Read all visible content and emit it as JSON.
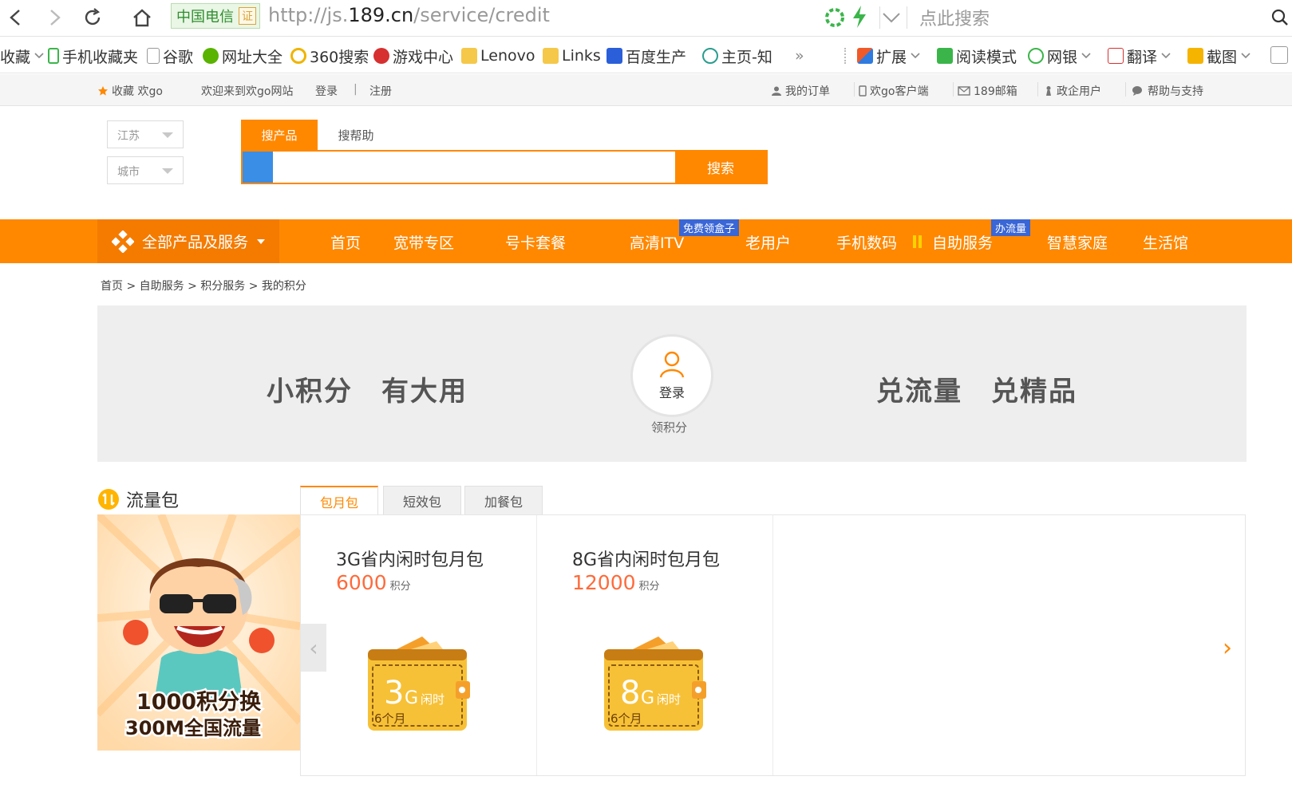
{
  "browser": {
    "cert_name": "中国电信",
    "cert_badge": "证",
    "url_prefix": "http://js.",
    "url_domain": "189.cn",
    "url_suffix": "/service/credit",
    "search_placeholder": "点此搜索"
  },
  "bookmarks": [
    {
      "label": "收藏",
      "icon": "star-icon"
    },
    {
      "label": "手机收藏夹",
      "icon": "phone-icon"
    },
    {
      "label": "谷歌",
      "icon": "page-icon"
    },
    {
      "label": "网址大全",
      "icon": "plus-circle-icon"
    },
    {
      "label": "360搜索",
      "icon": "circle-icon"
    },
    {
      "label": "游戏中心",
      "icon": "game-icon"
    },
    {
      "label": "Lenovo",
      "icon": "folder-icon"
    },
    {
      "label": "Links",
      "icon": "folder-icon"
    },
    {
      "label": "百度生产",
      "icon": "paw-icon"
    },
    {
      "label": "主页-知",
      "icon": "zhi-icon"
    },
    {
      "label": "»",
      "icon": "more-icon"
    }
  ],
  "bookmark_tools": [
    {
      "label": "扩展",
      "icon": "extension-icon"
    },
    {
      "label": "阅读模式",
      "icon": "book-icon"
    },
    {
      "label": "网银",
      "icon": "yen-icon"
    },
    {
      "label": "翻译",
      "icon": "translate-icon"
    },
    {
      "label": "截图",
      "icon": "screenshot-icon"
    }
  ],
  "topbar": {
    "fav": "收藏 欢go",
    "welcome": "欢迎来到欢go网站",
    "login": "登录",
    "sep": "|",
    "register": "注册",
    "links": [
      "我的订单",
      "欢go客户端",
      "189邮箱",
      "政企用户",
      "帮助与支持"
    ]
  },
  "header": {
    "province": "江苏",
    "city": "城市",
    "tab_products": "搜产品",
    "tab_help": "搜帮助",
    "search_button": "搜索"
  },
  "nav": {
    "all_products": "全部产品及服务",
    "items": [
      "首页",
      "宽带专区",
      "号卡套餐",
      "高清ITV",
      "老用户",
      "手机数码",
      "自助服务",
      "智慧家庭",
      "生活馆"
    ],
    "tag_itv": "免费领盒子",
    "tag_self": "办流量"
  },
  "breadcrumb": {
    "text": "首页 > 自助服务 > 积分服务 > 我的积分"
  },
  "banner": {
    "slogan_left": "小积分　有大用",
    "slogan_right": "兑流量　兑精品",
    "login_label": "登录",
    "collect_label": "领积分"
  },
  "traffic": {
    "title": "流量包",
    "tabs": [
      "包月包",
      "短效包",
      "加餐包"
    ],
    "promo_line1": "1000积分换",
    "promo_line2": "300M全国流量",
    "cards": [
      {
        "name": "3G省内闲时包月包",
        "points": "6000",
        "unit": "积分",
        "size": "3",
        "size_unit": "G",
        "tag": "闲时",
        "period": "6个月"
      },
      {
        "name": "8G省内闲时包月包",
        "points": "12000",
        "unit": "积分",
        "size": "8",
        "size_unit": "G",
        "tag": "闲时",
        "period": "6个月"
      }
    ]
  },
  "colors": {
    "accent": "#ff8800",
    "points": "#ff6a3a",
    "blue": "#3a8ee6"
  }
}
